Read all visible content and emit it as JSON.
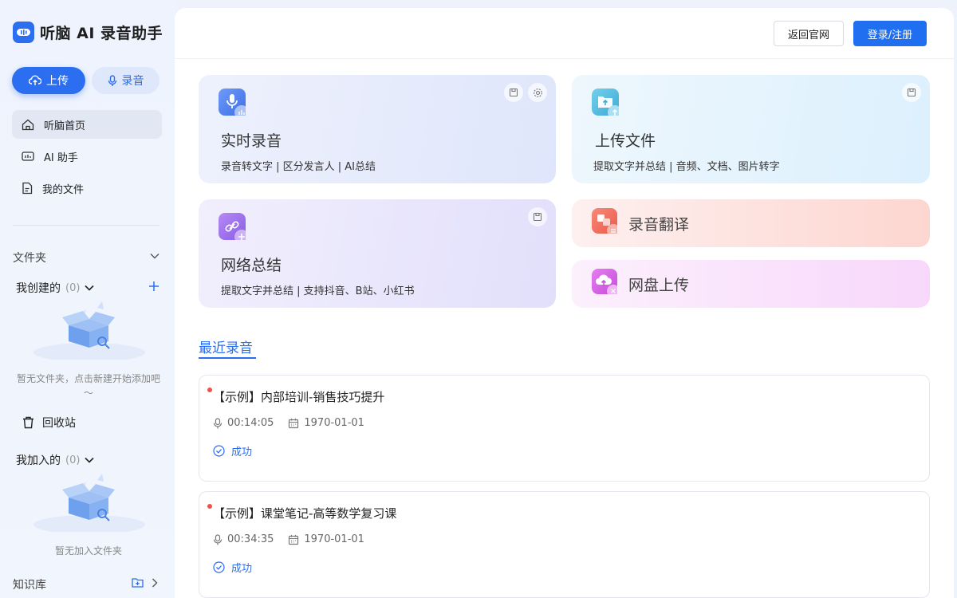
{
  "app": {
    "title": "听脑 AI 录音助手"
  },
  "sidebar": {
    "upload_label": "上传",
    "record_label": "录音",
    "nav": [
      {
        "label": "听脑首页",
        "icon": "home-icon"
      },
      {
        "label": "AI 助手",
        "icon": "ai-assistant-icon"
      },
      {
        "label": "我的文件",
        "icon": "file-icon"
      }
    ],
    "folders_title": "文件夹",
    "created": {
      "label": "我创建的",
      "count": "(0)",
      "empty_text": "暂无文件夹，点击新建开始添加吧～"
    },
    "trash_label": "回收站",
    "joined": {
      "label": "我加入的",
      "count": "(0)",
      "empty_text": "暂无加入文件夹"
    },
    "knowledge_label": "知识库"
  },
  "header": {
    "back_label": "返回官网",
    "login_label": "登录/注册"
  },
  "cards": {
    "realtime": {
      "title": "实时录音",
      "desc": "录音转文字 | 区分发言人 | AI总结"
    },
    "upload": {
      "title": "上传文件",
      "desc": "提取文字并总结 | 音频、文档、图片转字"
    },
    "web": {
      "title": "网络总结",
      "desc": "提取文字并总结 | 支持抖音、B站、小红书"
    },
    "translate": {
      "title": "录音翻译"
    },
    "cloud": {
      "title": "网盘上传"
    }
  },
  "recent": {
    "title": "最近录音",
    "items": [
      {
        "title": "【示例】内部培训-销售技巧提升",
        "duration": "00:14:05",
        "date": "1970-01-01",
        "status": "成功"
      },
      {
        "title": "【示例】课堂笔记-高等数学复习课",
        "duration": "00:34:35",
        "date": "1970-01-01",
        "status": "成功"
      }
    ]
  },
  "colors": {
    "primary": "#2b6ef0",
    "danger_dot": "#f0524b"
  }
}
